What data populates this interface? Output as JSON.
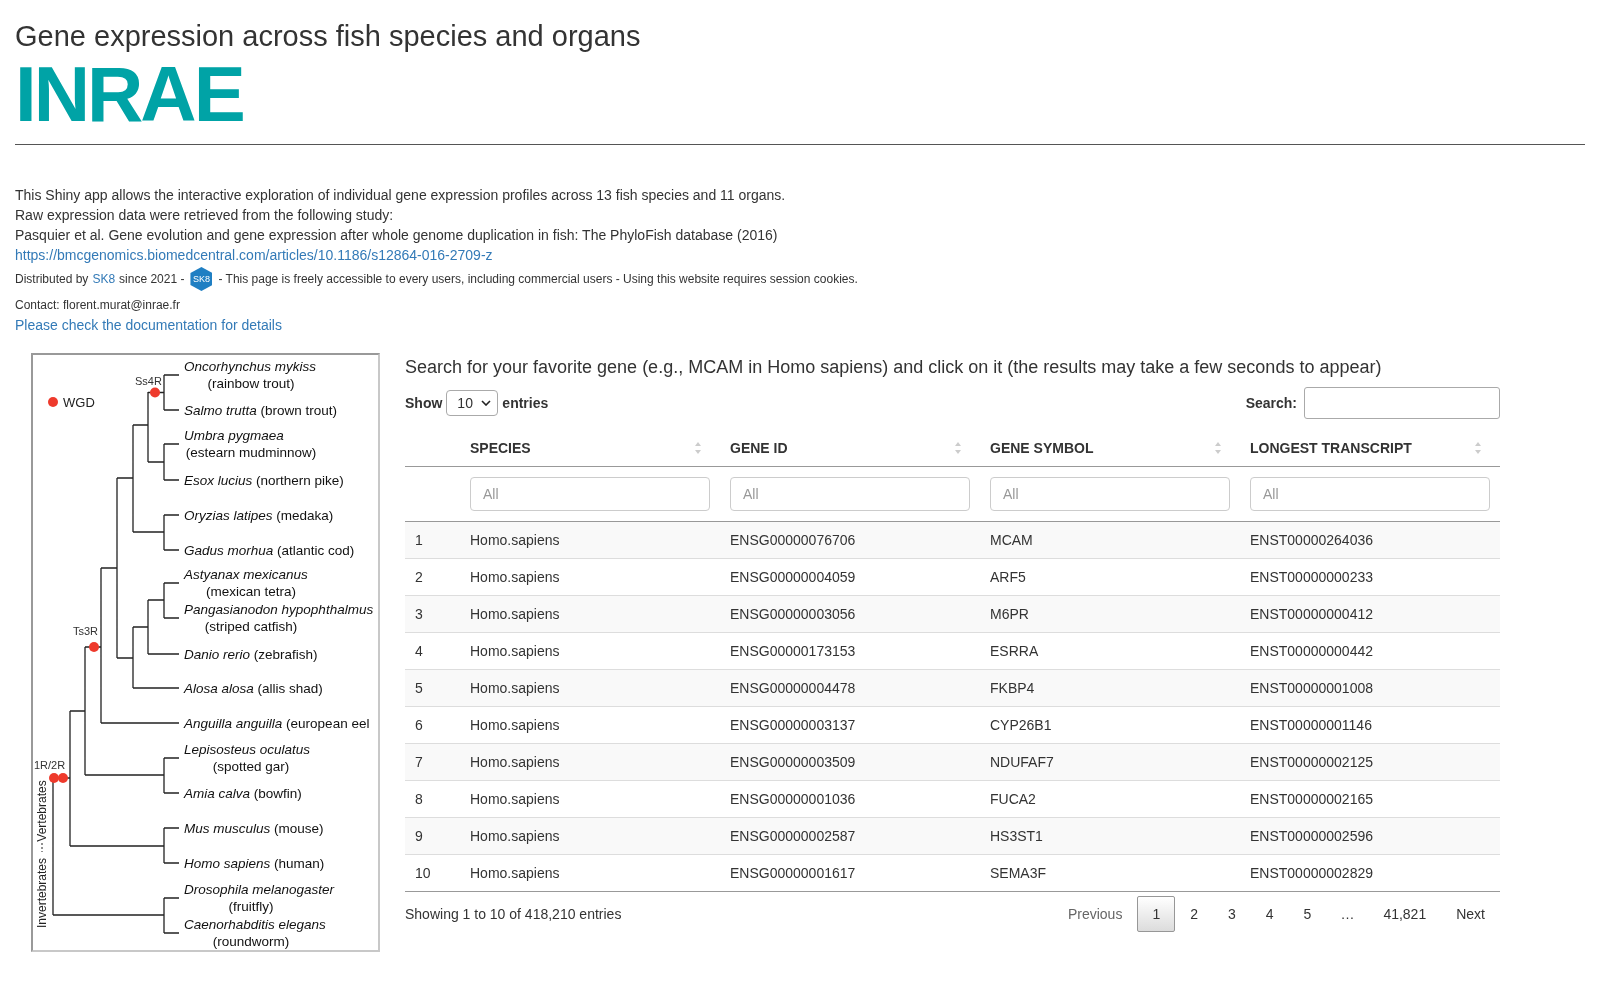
{
  "page": {
    "title": "Gene expression across fish species and organs",
    "logo": "INRAE"
  },
  "intro": {
    "lines": [
      "This Shiny app allows the interactive exploration of individual gene expression profiles across 13 fish species and 11 organs.",
      "Raw expression data were retrieved from the following study:",
      "Pasquier et al. Gene evolution and gene expression after whole genome duplication in fish: The PhyloFish database (2016)"
    ],
    "study_link": "https://bmcgenomics.biomedcentral.com/articles/10.1186/s12864-016-2709-z",
    "distribution": {
      "prefix": "Distributed by",
      "sk8_link": "SK8",
      "since": "since 2021 -",
      "badge": "SK8",
      "notice": "- This page is freely accessible to every users, including commercial users - Using this website requires session cookies."
    },
    "contact": "Contact: florent.murat@inrae.fr",
    "doc_link": "Please check the documentation for details"
  },
  "tree": {
    "legend": "WGD",
    "events": [
      "Ss4R",
      "Ts3R",
      "1R/2R"
    ],
    "groups": [
      "Vertebrates",
      "Invertebrates"
    ],
    "leaves": [
      {
        "latin": "Oncorhynchus mykiss",
        "common": "(rainbow trout)",
        "kind": "two_line"
      },
      {
        "latin": "Salmo trutta",
        "common": "(brown trout)",
        "kind": "one_line"
      },
      {
        "latin": "Umbra pygmaea",
        "common": "(estearn mudminnow)",
        "kind": "two_line"
      },
      {
        "latin": "Esox lucius",
        "common": "(northern pike)",
        "kind": "one_line"
      },
      {
        "latin": "Oryzias latipes",
        "common": "(medaka)",
        "kind": "one_line"
      },
      {
        "latin": "Gadus morhua",
        "common": "(atlantic cod)",
        "kind": "one_line"
      },
      {
        "latin": "Astyanax mexicanus",
        "common": "(mexican tetra)",
        "kind": "two_line"
      },
      {
        "latin": "Pangasianodon hypophthalmus",
        "common": "(striped catfish)",
        "kind": "two_line"
      },
      {
        "latin": "Danio rerio",
        "common": "(zebrafish)",
        "kind": "one_line"
      },
      {
        "latin": "Alosa alosa",
        "common": "(allis shad)",
        "kind": "one_line"
      },
      {
        "latin": "Anguilla anguilla",
        "common": "(european eel",
        "kind": "one_line"
      },
      {
        "latin": "Lepisosteus oculatus",
        "common": "(spotted gar)",
        "kind": "two_line"
      },
      {
        "latin": "Amia calva",
        "common": "(bowfin)",
        "kind": "one_line"
      },
      {
        "latin": "Mus musculus",
        "common": "(mouse)",
        "kind": "one_line"
      },
      {
        "latin": "Homo sapiens",
        "common": "(human)",
        "kind": "one_line"
      },
      {
        "latin": "Drosophila melanogaster",
        "common": "(fruitfly)",
        "kind": "two_line"
      },
      {
        "latin": "Caenorhabditis elegans",
        "common": "(roundworm)",
        "kind": "two_line"
      }
    ]
  },
  "table_section": {
    "heading": "Search for your favorite gene (e.g., MCAM in Homo sapiens) and click on it (the results may take a few seconds to appear)",
    "length": {
      "show": "Show",
      "value": "10",
      "entries": "entries"
    },
    "search": {
      "label": "Search:"
    },
    "columns": [
      {
        "kind": "index"
      },
      {
        "label": "SPECIES",
        "filter_placeholder": "All"
      },
      {
        "label": "GENE ID",
        "filter_placeholder": "All"
      },
      {
        "label": "GENE SYMBOL",
        "filter_placeholder": "All"
      },
      {
        "label": "LONGEST TRANSCRIPT",
        "filter_placeholder": "All"
      }
    ],
    "rows": [
      [
        "1",
        "Homo.sapiens",
        "ENSG00000076706",
        "MCAM",
        "ENST00000264036"
      ],
      [
        "2",
        "Homo.sapiens",
        "ENSG00000004059",
        "ARF5",
        "ENST00000000233"
      ],
      [
        "3",
        "Homo.sapiens",
        "ENSG00000003056",
        "M6PR",
        "ENST00000000412"
      ],
      [
        "4",
        "Homo.sapiens",
        "ENSG00000173153",
        "ESRRA",
        "ENST00000000442"
      ],
      [
        "5",
        "Homo.sapiens",
        "ENSG00000004478",
        "FKBP4",
        "ENST00000001008"
      ],
      [
        "6",
        "Homo.sapiens",
        "ENSG00000003137",
        "CYP26B1",
        "ENST00000001146"
      ],
      [
        "7",
        "Homo.sapiens",
        "ENSG00000003509",
        "NDUFAF7",
        "ENST00000002125"
      ],
      [
        "8",
        "Homo.sapiens",
        "ENSG00000001036",
        "FUCA2",
        "ENST00000002165"
      ],
      [
        "9",
        "Homo.sapiens",
        "ENSG00000002587",
        "HS3ST1",
        "ENST00000002596"
      ],
      [
        "10",
        "Homo.sapiens",
        "ENSG00000001617",
        "SEMA3F",
        "ENST00000002829"
      ]
    ],
    "info": "Showing 1 to 10 of 418,210 entries",
    "pagination": [
      {
        "label": "Previous",
        "kind": "nav",
        "disabled": true
      },
      {
        "label": "1",
        "kind": "page",
        "selected": true
      },
      {
        "label": "2",
        "kind": "page",
        "selected": false
      },
      {
        "label": "3",
        "kind": "page",
        "selected": false
      },
      {
        "label": "4",
        "kind": "page",
        "selected": false
      },
      {
        "label": "5",
        "kind": "page",
        "selected": false
      },
      {
        "label": "…",
        "kind": "ellipsis"
      },
      {
        "label": "41,821",
        "kind": "page",
        "selected": false
      },
      {
        "label": "Next",
        "kind": "nav",
        "disabled": false
      }
    ]
  }
}
